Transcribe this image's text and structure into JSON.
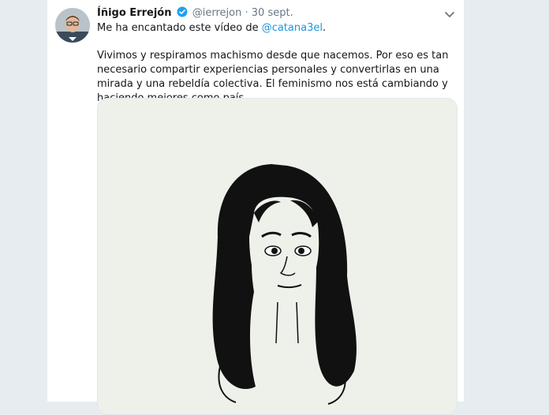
{
  "tweet": {
    "author_name": "Íñigo Errejón",
    "handle": "@ierrejon",
    "separator": "·",
    "date": "30 sept.",
    "intro_text": "Me ha encantado este vídeo de ",
    "mention": "@catana3el",
    "intro_suffix": ".",
    "body": "Vivimos y respiramos machismo desde que nacemos. Por eso es tan necesario compartir experiencias personales y convertirlas en una mirada y una rebeldía colectiva. El feminismo nos está cambiando y haciendo mejores como país."
  },
  "icons": {
    "verified": "verified-badge-icon",
    "menu": "chevron-down-icon"
  },
  "colors": {
    "page_bg": "#e6ecf0",
    "link": "#1b95e0",
    "muted": "#657786",
    "media_bg": "#edf1ea"
  }
}
